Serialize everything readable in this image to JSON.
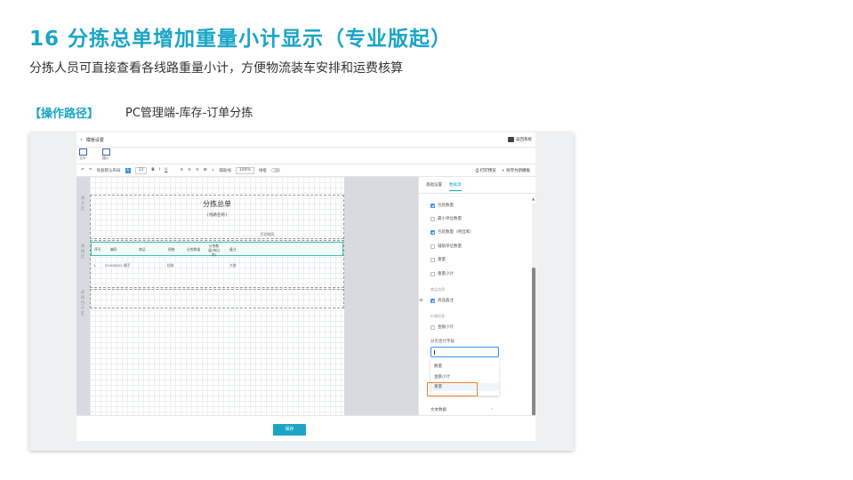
{
  "slide": {
    "title": "16  分拣总单增加重量小计显示（专业版起）",
    "subtitle": "分拣人员可直接查看各线路重量小计，方便物流装车安排和运费核算",
    "path_label": "【操作路径】",
    "path_value": "PC管理端-库存-订单分拣"
  },
  "app": {
    "topbar": {
      "title": "模板设置",
      "return_label": "返回系统"
    },
    "icons": [
      {
        "label": "文字",
        "icon": "text-icon"
      },
      {
        "label": "图片",
        "icon": "image-icon"
      }
    ],
    "toolbar": {
      "restore_label": "恢复默认布局",
      "font_size": "13",
      "bold": "B",
      "italic": "I",
      "underline": "U",
      "grid_label": "辅助线",
      "zoom": "100%",
      "line_label": "线框",
      "print_preview": "打印预览",
      "save_as_new": "另存为新模板"
    },
    "canvas": {
      "side_labels": [
        "表头区",
        "表格区",
        "表格合计区"
      ],
      "doc_title": "分拣总单",
      "doc_subtitle": "{线路名称}",
      "print_time": "打印时间：",
      "table_headers": [
        "序号",
        "编码",
        "商品",
        "规格",
        "分拣数量",
        "分拣数量(待出库)",
        "备注"
      ],
      "table_row": [
        "1",
        "S1000001",
        "橘子",
        "粒装",
        "",
        "",
        "大袋"
      ]
    },
    "panel": {
      "tabs": [
        "基础设置",
        "数据源"
      ],
      "options": [
        {
          "label": "包装数量",
          "checked": true
        },
        {
          "label": "最小单位数量",
          "checked": false
        },
        {
          "label": "包装数量（待出库）",
          "checked": true
        },
        {
          "label": "辅助单位数量",
          "checked": false
        },
        {
          "label": "重量",
          "checked": false
        },
        {
          "label": "重量小计",
          "checked": false
        }
      ],
      "group_goods": "商品信息",
      "goods_remark": {
        "label": "商品备注",
        "checked": true
      },
      "group_amount": "价格信息",
      "amount_subtotal": {
        "label": "金额小计",
        "checked": false
      },
      "subtotal_field_label": "分页合计字段",
      "dropdown": [
        "数量",
        "金额小计",
        "重量"
      ],
      "collapse_label": "文本数据",
      "collapse_arrow": "›"
    },
    "save_label": "保存"
  }
}
